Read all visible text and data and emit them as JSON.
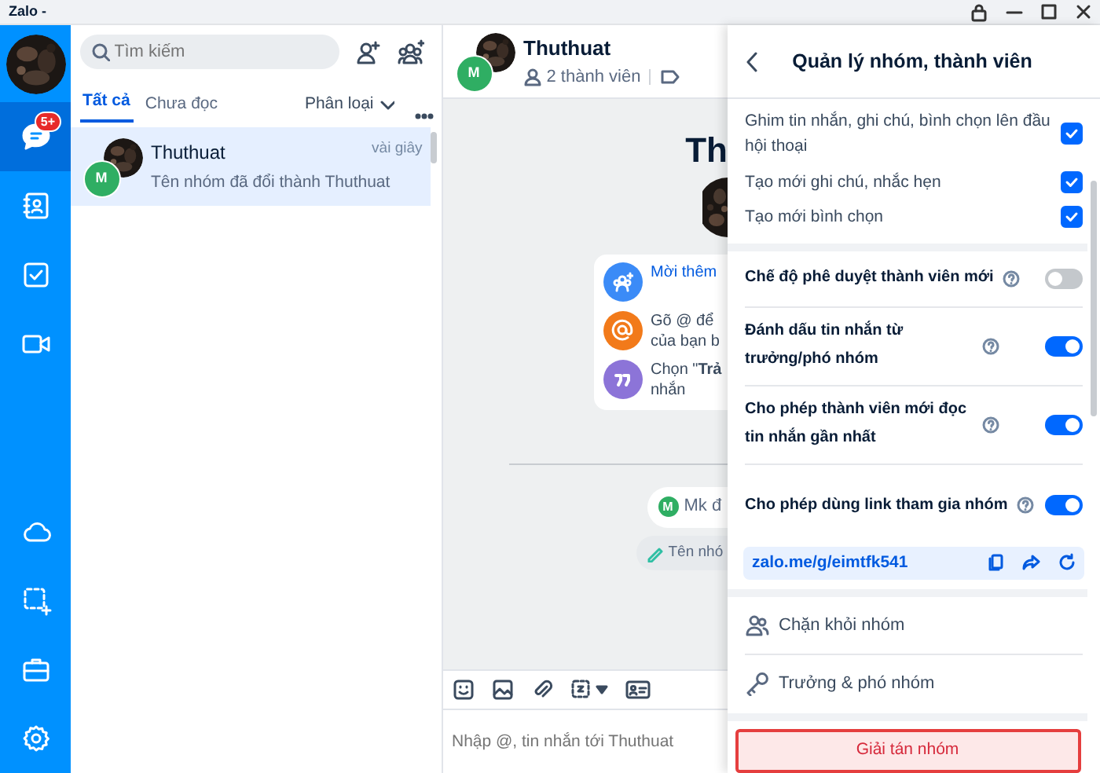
{
  "window": {
    "title": "Zalo -"
  },
  "nav_rail": {
    "items": [
      {
        "kind": "chat",
        "badge": "5+",
        "selected": true
      },
      {
        "kind": "contacts",
        "selected": false
      },
      {
        "kind": "todo",
        "selected": false
      },
      {
        "kind": "video",
        "selected": false
      },
      {
        "kind": "cloud",
        "selected": false
      },
      {
        "kind": "capture",
        "selected": false
      },
      {
        "kind": "toolbox",
        "selected": false
      },
      {
        "kind": "settings",
        "selected": false
      }
    ]
  },
  "conversation_list": {
    "search": {
      "placeholder": "Tìm kiếm"
    },
    "tabs": [
      {
        "label": "Tất cả",
        "selected": true
      },
      {
        "label": "Chưa đọc",
        "selected": false
      }
    ],
    "filter": "Phân loại",
    "items": [
      {
        "name": "Thuthuat",
        "avatar_initial": "M",
        "time": "vài giây",
        "preview": "Tên nhóm đã đổi thành Thuthuat",
        "selected": true
      }
    ]
  },
  "chat": {
    "header": {
      "name": "Thuthuat",
      "avatar_initial": "M",
      "members": "2 thành viên"
    },
    "title": "Th",
    "tips": [
      {
        "kind": "invite",
        "lines": [
          "Mời thêm"
        ]
      },
      {
        "kind": "mention",
        "lines": [
          "Gõ @ để",
          "của bạn b"
        ]
      },
      {
        "kind": "quote",
        "lines": [
          "Chọn \"**Trả**",
          "nhắn"
        ]
      }
    ],
    "message": {
      "initial": "M",
      "text": "Mk đ"
    },
    "notice": "Tên nhó",
    "composer": {
      "placeholder": "Nhập @, tin nhắn tới Thuthuat"
    }
  },
  "panel": {
    "title": "Quản lý nhóm, thành viên",
    "permissions": [
      {
        "label": "Ghim tin nhắn, ghi chú, bình chọn lên đầu hội thoại",
        "checked": true
      },
      {
        "label": "Tạo mới ghi chú, nhắc hẹn",
        "checked": true
      },
      {
        "label": "Tạo mới bình chọn",
        "checked": true
      }
    ],
    "settings": [
      {
        "label": "Chế độ phê duyệt thành viên mới",
        "on": false
      },
      {
        "label": "Đánh dấu tin nhắn từ trưởng/phó nhóm",
        "on": true
      },
      {
        "label": "Cho phép thành viên mới đọc tin nhắn gần nhất",
        "on": true
      },
      {
        "label": "Cho phép dùng link tham gia nhóm",
        "on": true
      }
    ],
    "link": "zalo.me/g/eimtfk541",
    "actions": [
      {
        "kind": "block",
        "label": "Chặn khỏi nhóm"
      },
      {
        "kind": "admins",
        "label": "Trưởng & phó nhóm"
      }
    ],
    "danger_button": "Giải tán nhóm"
  }
}
